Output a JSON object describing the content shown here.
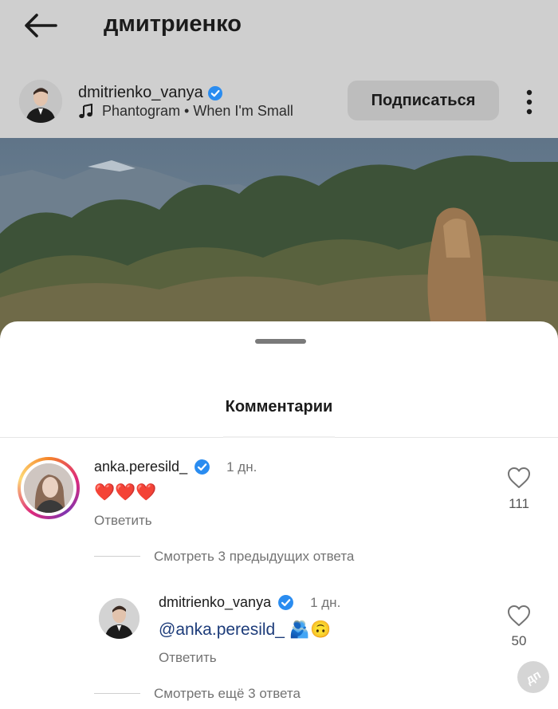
{
  "header": {
    "title": "дмитриенко"
  },
  "post": {
    "username": "dmitrienko_vanya",
    "music": "Phantogram • When I'm Small",
    "follow_label": "Подписаться"
  },
  "sheet": {
    "title": "Комментарии"
  },
  "comments": [
    {
      "username": "anka.peresild_",
      "time": "1 дн.",
      "text": "❤️❤️❤️",
      "reply_label": "Ответить",
      "likes": "111",
      "thread_label": "Смотреть 3 предыдущих ответа"
    },
    {
      "username": "dmitrienko_vanya",
      "time": "1 дн.",
      "mention": "@anka.peresild_",
      "emoji": "🫂🙃",
      "reply_label": "Ответить",
      "likes": "50",
      "thread_label": "Смотреть ещё 3 ответа"
    }
  ],
  "watermark": {
    "text": "дп"
  },
  "colors": {
    "verified": "#2a8cf0",
    "heart_red": "#e0245e",
    "muted_text": "#737373"
  }
}
